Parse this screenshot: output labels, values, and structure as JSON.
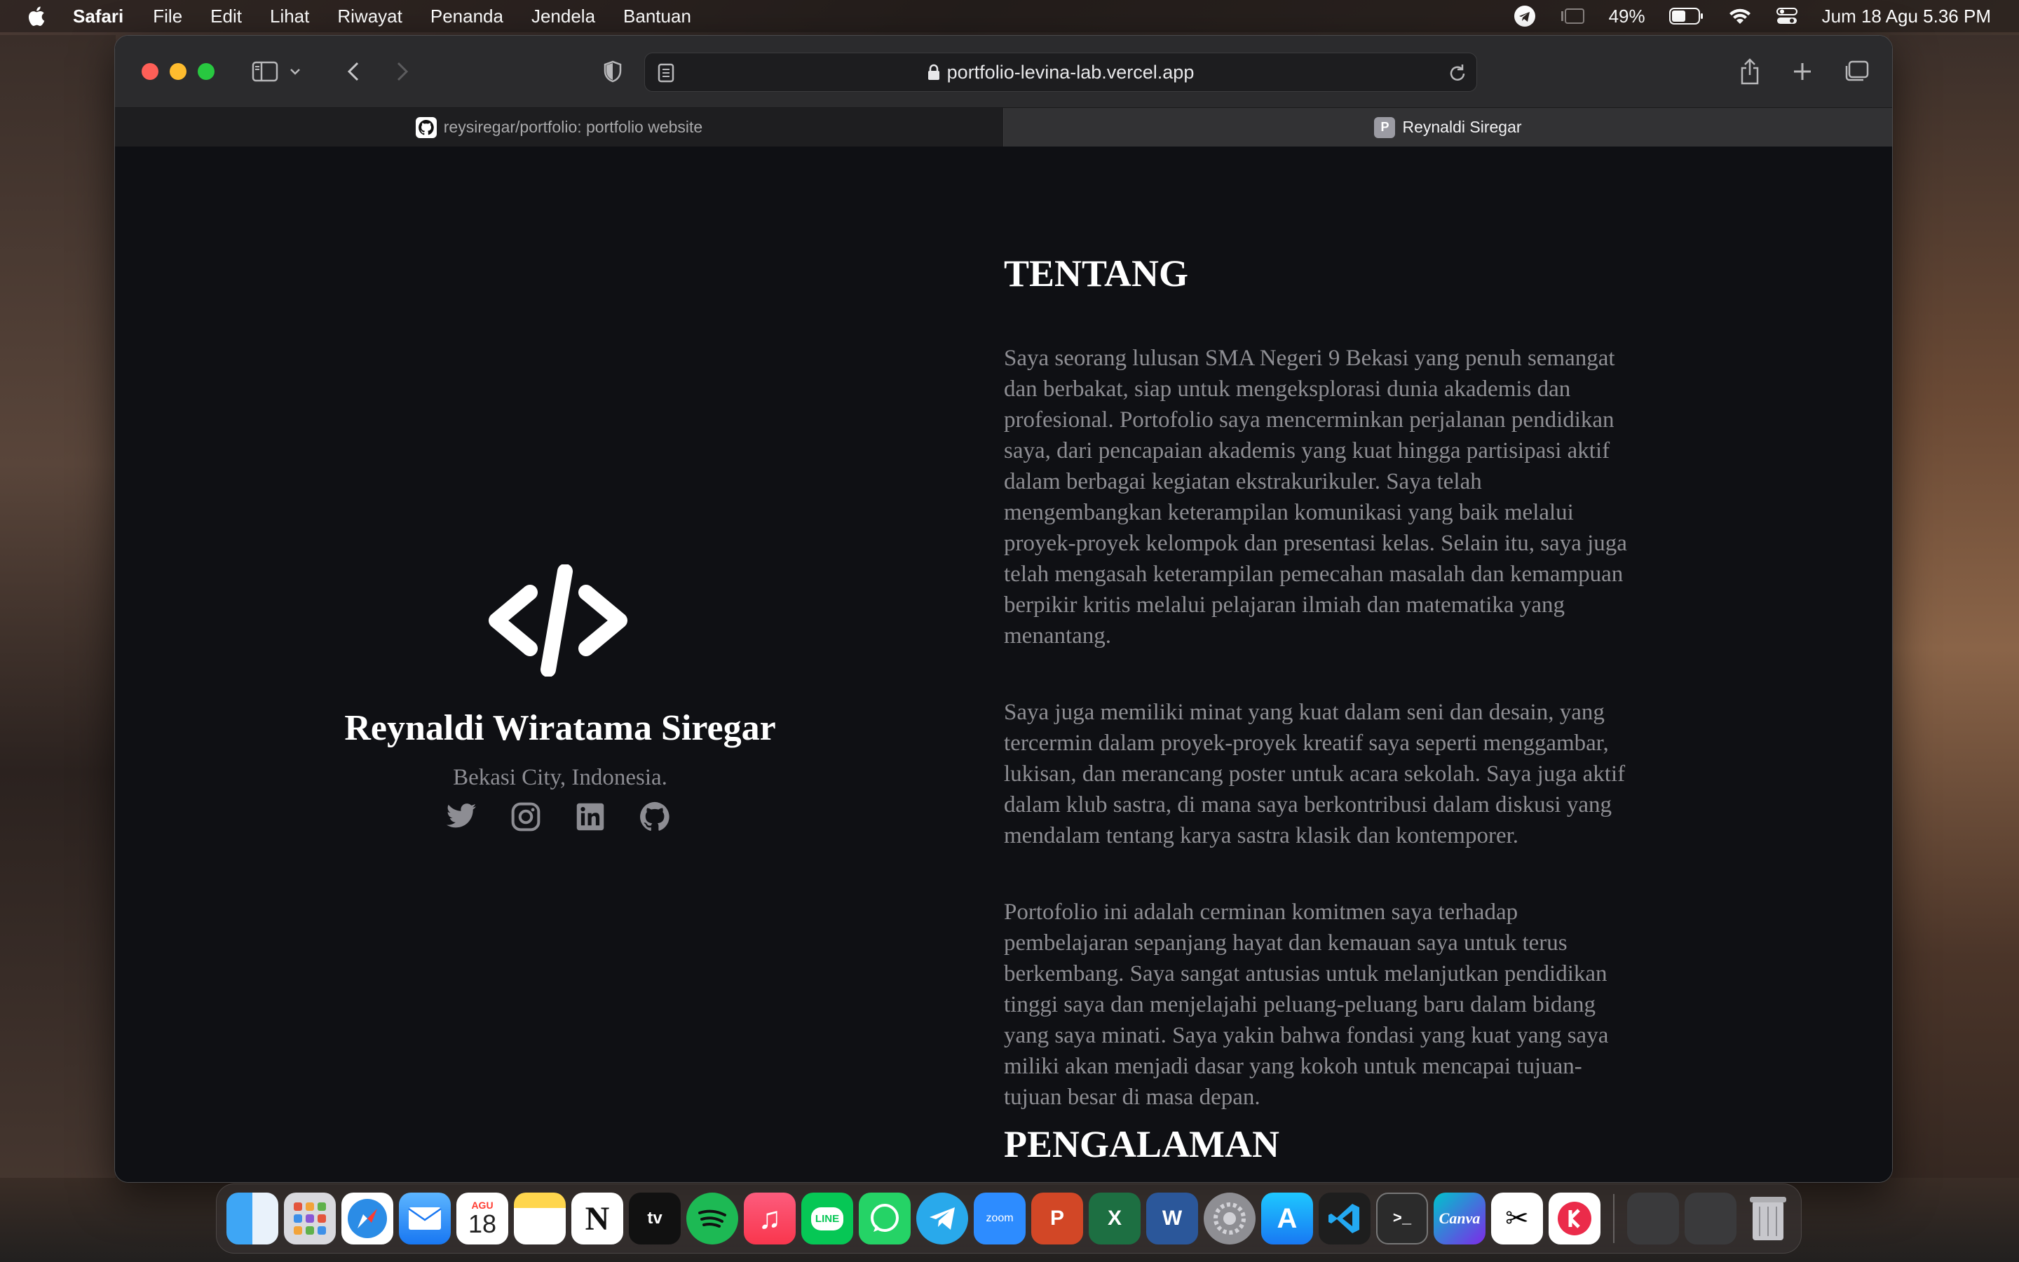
{
  "menubar": {
    "app_name": "Safari",
    "items": [
      "File",
      "Edit",
      "Lihat",
      "Riwayat",
      "Penanda",
      "Jendela",
      "Bantuan"
    ],
    "battery": "49%",
    "datetime": "Jum 18 Agu  5.36 PM"
  },
  "browser": {
    "url": "portfolio-levina-lab.vercel.app",
    "tabs": [
      {
        "label": "reysiregar/portfolio: portfolio website",
        "favicon": "github-icon"
      },
      {
        "label": "Reynaldi Siregar",
        "favicon": "P"
      }
    ]
  },
  "profile": {
    "name": "Reynaldi Wiratama Siregar",
    "location": "Bekasi City, Indonesia.",
    "socials": [
      "twitter-icon",
      "instagram-icon",
      "linkedin-icon",
      "github-icon"
    ]
  },
  "about": {
    "heading": "TENTANG",
    "paragraphs": [
      "Saya seorang lulusan SMA Negeri 9 Bekasi yang penuh semangat dan berbakat, siap untuk mengeksplorasi dunia akademis dan profesional. Portofolio saya mencerminkan perjalanan pendidikan saya, dari pencapaian akademis yang kuat hingga partisipasi aktif dalam berbagai kegiatan ekstrakurikuler. Saya telah mengembangkan keterampilan komunikasi yang baik melalui proyek-proyek kelompok dan presentasi kelas. Selain itu, saya juga telah mengasah keterampilan pemecahan masalah dan kemampuan berpikir kritis melalui pelajaran ilmiah dan matematika yang menantang.",
      "Saya juga memiliki minat yang kuat dalam seni dan desain, yang tercermin dalam proyek-proyek kreatif saya seperti menggambar, lukisan, dan merancang poster untuk acara sekolah. Saya juga aktif dalam klub sastra, di mana saya berkontribusi dalam diskusi yang mendalam tentang karya sastra klasik dan kontemporer.",
      "Portofolio ini adalah cerminan komitmen saya terhadap pembelajaran sepanjang hayat dan kemauan saya untuk terus berkembang. Saya sangat antusias untuk melanjutkan pendidikan tinggi saya dan menjelajahi peluang-peluang baru dalam bidang yang saya minati. Saya yakin bahwa fondasi yang kuat yang saya miliki akan menjadi dasar yang kokoh untuk mencapai tujuan-tujuan besar di masa depan."
    ],
    "next_heading": "PENGALAMAN"
  },
  "dock": {
    "calendar_month": "AGU",
    "calendar_day": "18",
    "apps": [
      "finder",
      "launchpad",
      "safari",
      "mail",
      "calendar",
      "notes",
      "notion",
      "apple-tv",
      "spotify",
      "music",
      "line",
      "whatsapp",
      "telegram",
      "zoom",
      "powerpoint",
      "excel",
      "word",
      "system-settings",
      "app-store",
      "vscode",
      "terminal",
      "canva",
      "capcut",
      "kinemaster",
      "trash"
    ],
    "labels": {
      "tv": "tv",
      "zoom": "zoom",
      "canva": "Canva",
      "line": "LINE"
    }
  },
  "colors": {
    "page_bg": "#0f1014",
    "heading": "#ffffff",
    "body_text": "#8e8e93"
  }
}
